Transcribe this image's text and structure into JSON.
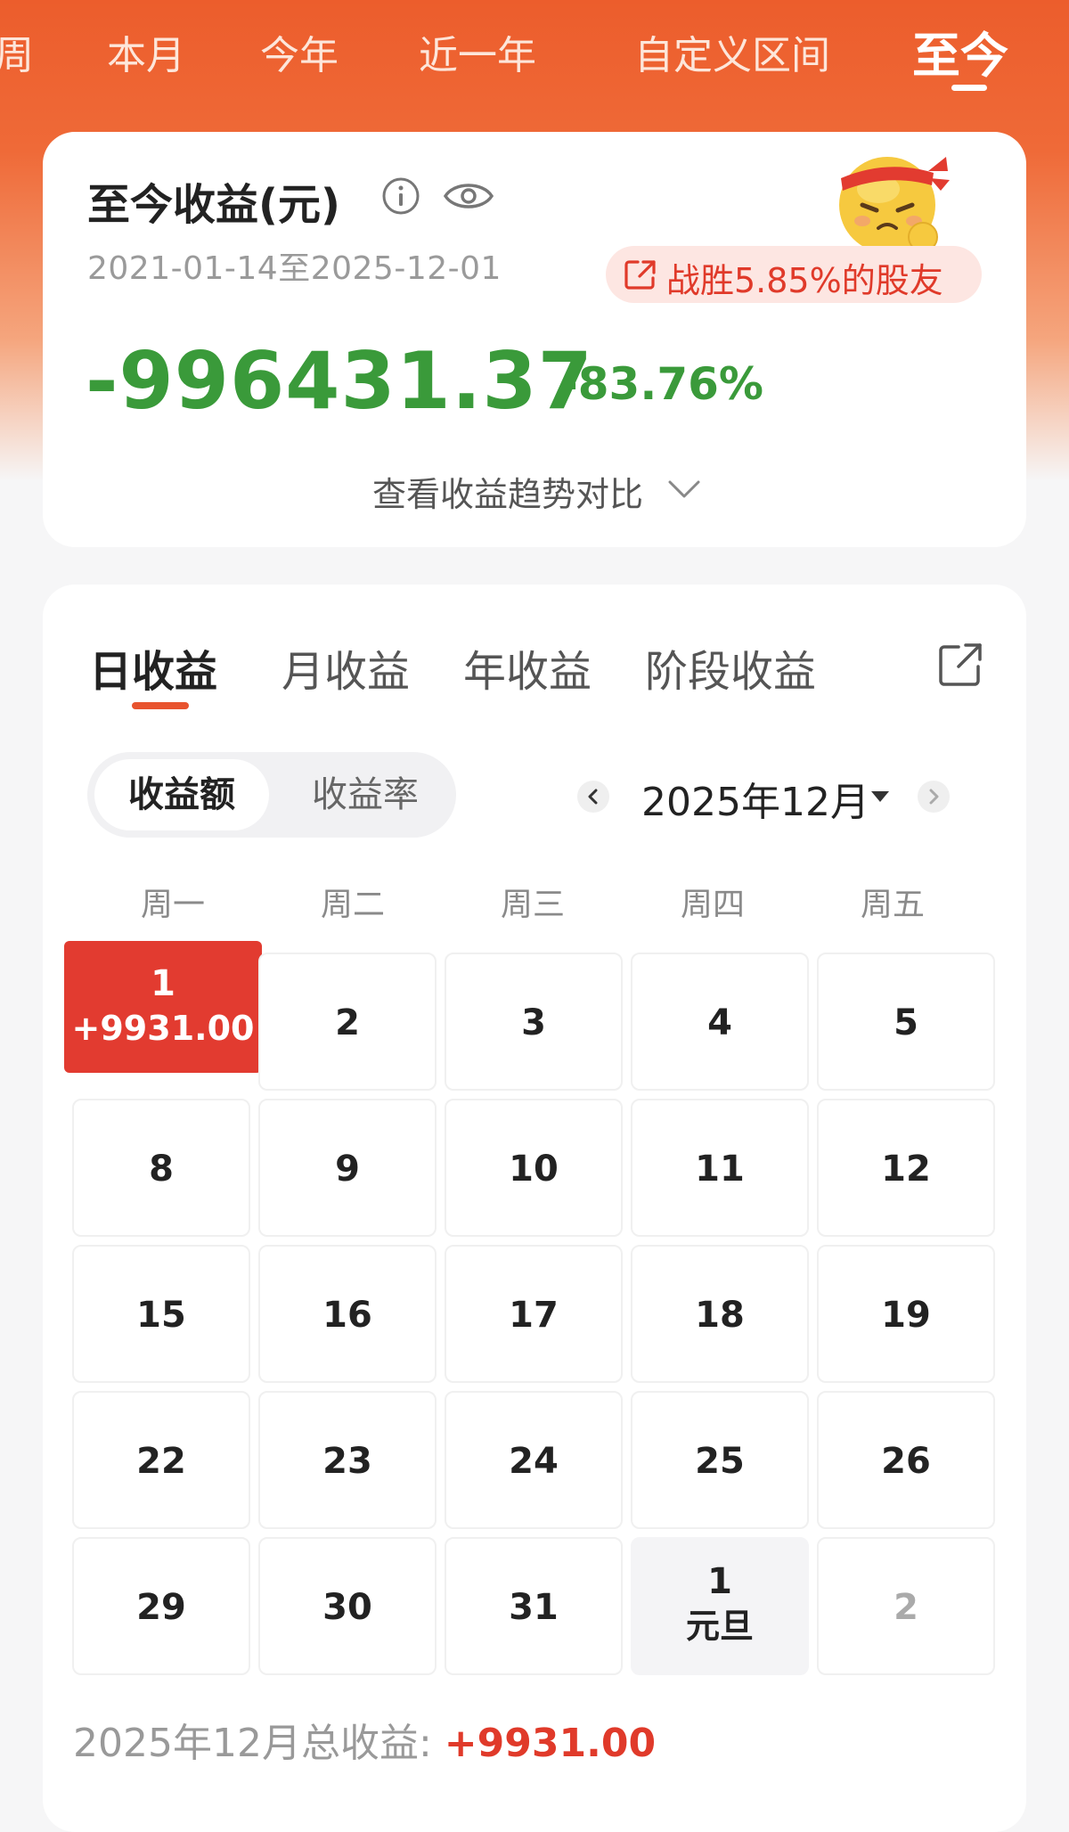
{
  "period_tabs": [
    "周",
    "本月",
    "今年",
    "近一年",
    "自定义区间",
    "至今"
  ],
  "summary": {
    "title": "至今收益(元)",
    "date_range": "2021-01-14至2025-12-01",
    "beat_text": "战胜5.85%的股友",
    "total_value": "-996431.37",
    "total_rate": "-83.76%",
    "trend_link": "查看收益趋势对比"
  },
  "type_tabs": [
    "日收益",
    "月收益",
    "年收益",
    "阶段收益"
  ],
  "segment": {
    "amount": "收益额",
    "rate": "收益率"
  },
  "month_label": "2025年12月",
  "weekdays": [
    "周一",
    "周二",
    "周三",
    "周四",
    "周五"
  ],
  "calendar": {
    "highlight": {
      "day": "1",
      "value": "+9931.00"
    },
    "days": [
      "2",
      "3",
      "4",
      "5",
      "8",
      "9",
      "10",
      "11",
      "12",
      "15",
      "16",
      "17",
      "18",
      "19",
      "22",
      "23",
      "24",
      "25",
      "26",
      "29",
      "30",
      "31"
    ],
    "holiday": {
      "day": "1",
      "label": "元旦"
    },
    "next_month_day": "2"
  },
  "month_total": {
    "label": "2025年12月总收益: ",
    "value": "+9931.00"
  },
  "colors": {
    "brand": "#ec5d2c",
    "gain": "#e23b30",
    "loss": "#3a9a3a"
  }
}
